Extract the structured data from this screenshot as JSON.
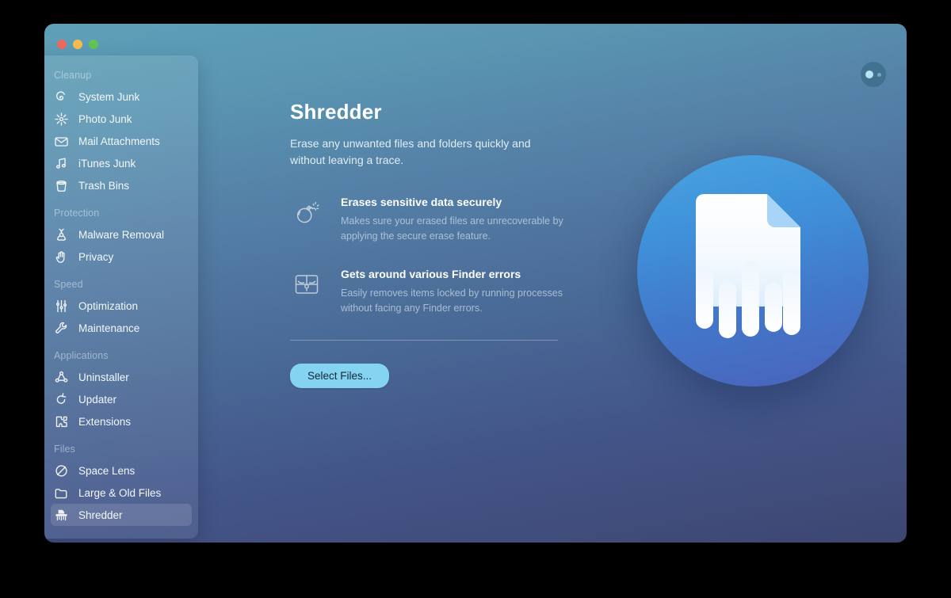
{
  "window": {
    "traffic_lights": [
      {
        "name": "close",
        "color": "#ee6a5f"
      },
      {
        "name": "minimize",
        "color": "#f5bd4f"
      },
      {
        "name": "maximize",
        "color": "#61c454"
      }
    ],
    "menu_button_icon": "two-dots-icon"
  },
  "sidebar": {
    "groups": [
      {
        "label": "Cleanup",
        "items": [
          {
            "label": "System Junk",
            "icon": "broom-icon",
            "active": false
          },
          {
            "label": "Photo Junk",
            "icon": "flower-icon",
            "active": false
          },
          {
            "label": "Mail Attachments",
            "icon": "envelope-icon",
            "active": false
          },
          {
            "label": "iTunes Junk",
            "icon": "music-note-icon",
            "active": false
          },
          {
            "label": "Trash Bins",
            "icon": "trash-bin-icon",
            "active": false
          }
        ]
      },
      {
        "label": "Protection",
        "items": [
          {
            "label": "Malware Removal",
            "icon": "biohazard-icon",
            "active": false
          },
          {
            "label": "Privacy",
            "icon": "hand-icon",
            "active": false
          }
        ]
      },
      {
        "label": "Speed",
        "items": [
          {
            "label": "Optimization",
            "icon": "sliders-icon",
            "active": false
          },
          {
            "label": "Maintenance",
            "icon": "wrench-icon",
            "active": false
          }
        ]
      },
      {
        "label": "Applications",
        "items": [
          {
            "label": "Uninstaller",
            "icon": "molecule-icon",
            "active": false
          },
          {
            "label": "Updater",
            "icon": "refresh-arrow-icon",
            "active": false
          },
          {
            "label": "Extensions",
            "icon": "puzzle-piece-icon",
            "active": false
          }
        ]
      },
      {
        "label": "Files",
        "items": [
          {
            "label": "Space Lens",
            "icon": "planet-icon",
            "active": false
          },
          {
            "label": "Large & Old Files",
            "icon": "folder-icon",
            "active": false
          },
          {
            "label": "Shredder",
            "icon": "shredder-icon",
            "active": true
          }
        ]
      }
    ]
  },
  "main": {
    "title": "Shredder",
    "description": "Erase any unwanted files and folders quickly and without leaving a trace.",
    "features": [
      {
        "icon": "bomb-icon",
        "title": "Erases sensitive data securely",
        "body": "Makes sure your erased files are unrecoverable by applying the secure erase feature."
      },
      {
        "icon": "locked-chest-icon",
        "title": "Gets around various Finder errors",
        "body": "Easily removes items locked by running processes without facing any Finder errors."
      }
    ],
    "primary_button": "Select Files...",
    "hero_icon": "shredded-document-icon"
  },
  "colors": {
    "accent_button": "#84d3f0",
    "window_top": "#5fa0b8",
    "window_bottom": "#3e4671",
    "hero_circle_top": "#4aa3e0",
    "hero_circle_bottom": "#4a63bb"
  }
}
